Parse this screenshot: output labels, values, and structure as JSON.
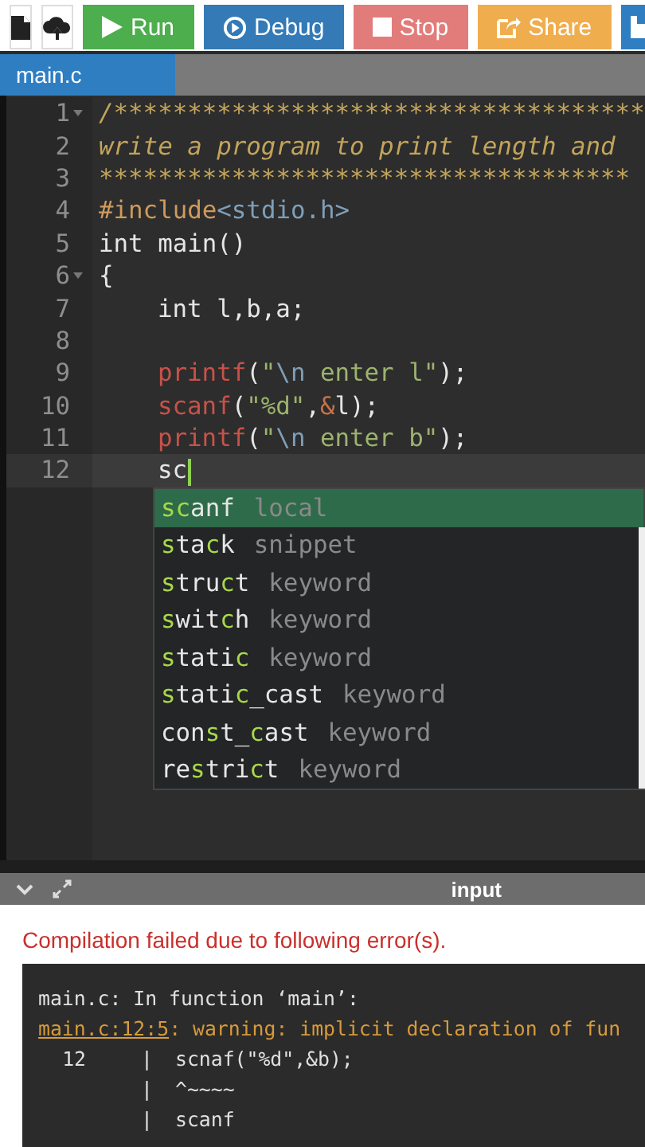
{
  "toolbar": {
    "buttons": [
      {
        "label": "Run",
        "color": "#4cae4c"
      },
      {
        "label": "Debug",
        "color": "#337ab7"
      },
      {
        "label": "Stop",
        "color": "#e27c7a"
      },
      {
        "label": "Share",
        "color": "#f0ad4e"
      }
    ]
  },
  "tabs": [
    {
      "label": "main.c",
      "selected": true
    }
  ],
  "editor": {
    "lines": [
      {
        "number": "1",
        "fold": true,
        "active": false,
        "tokens": [
          {
            "kind": "comment",
            "text": "/************************************"
          }
        ]
      },
      {
        "number": "2",
        "fold": false,
        "active": false,
        "tokens": [
          {
            "kind": "comment",
            "text": "write a program to print length and"
          }
        ]
      },
      {
        "number": "3",
        "fold": false,
        "active": false,
        "tokens": [
          {
            "kind": "comment",
            "text": "************************************"
          }
        ]
      },
      {
        "number": "4",
        "fold": false,
        "active": false,
        "tokens": [
          {
            "kind": "preproc",
            "text": "#include"
          },
          {
            "kind": "header",
            "text": "<stdio.h>"
          }
        ]
      },
      {
        "number": "5",
        "fold": false,
        "active": false,
        "tokens": [
          {
            "kind": "plain",
            "text": "int main()"
          }
        ]
      },
      {
        "number": "6",
        "fold": true,
        "active": false,
        "tokens": [
          {
            "kind": "plain",
            "text": "{"
          }
        ],
        "children": [
          {
            "number": "7",
            "fold": false,
            "active": false,
            "tokens": [
              {
                "kind": "plain",
                "text": "int l,b,a;"
              }
            ]
          },
          {
            "number": "8",
            "fold": false,
            "active": false
          },
          {
            "number": "9",
            "fold": false,
            "active": false,
            "tokens": [
              {
                "kind": "func",
                "text": "printf"
              },
              {
                "kind": "plain",
                "text": "("
              },
              {
                "kind": "string",
                "text": "\""
              },
              {
                "kind": "escape",
                "text": "\\n"
              },
              {
                "kind": "string",
                "text": " enter l\""
              },
              {
                "kind": "plain",
                "text": ");"
              }
            ]
          },
          {
            "number": "10",
            "fold": false,
            "active": false,
            "tokens": [
              {
                "kind": "func",
                "text": "scanf"
              },
              {
                "kind": "plain",
                "text": "("
              },
              {
                "kind": "string",
                "text": "\"%d\""
              },
              {
                "kind": "plain",
                "text": ","
              },
              {
                "kind": "op",
                "text": "&"
              },
              {
                "kind": "plain",
                "text": "l);"
              }
            ]
          },
          {
            "number": "11",
            "fold": false,
            "active": false,
            "tokens": [
              {
                "kind": "func",
                "text": "printf"
              },
              {
                "kind": "plain",
                "text": "("
              },
              {
                "kind": "string",
                "text": "\""
              },
              {
                "kind": "escape",
                "text": "\\n"
              },
              {
                "kind": "string",
                "text": " enter b\""
              },
              {
                "kind": "plain",
                "text": ");"
              }
            ]
          },
          {
            "number": "12",
            "fold": false,
            "active": true,
            "tokens": [
              {
                "kind": "plain",
                "text": "sc"
              }
            ]
          }
        ]
      }
    ],
    "autocomplete": [
      {
        "label": "**sc**anf",
        "meta": "local",
        "selected": true
      },
      {
        "label": "**s**ta**c**k",
        "meta": "snippet",
        "selected": false
      },
      {
        "label": "**s**tru**c**t",
        "meta": "keyword",
        "selected": false
      },
      {
        "label": "**s**wit**c**h",
        "meta": "keyword",
        "selected": false
      },
      {
        "label": "**s**tati**c**",
        "meta": "keyword",
        "selected": false
      },
      {
        "label": "**s**tati**c**_cast",
        "meta": "keyword",
        "selected": false
      },
      {
        "label": "con**s**t_**c**ast",
        "meta": "keyword",
        "selected": false
      },
      {
        "label": "re**s**tri**c**t",
        "meta": "keyword",
        "selected": false
      }
    ]
  },
  "output_bar": {
    "title": "input"
  },
  "output": {
    "status": "Compilation failed due to following error(s).",
    "console": [
      {
        "kind": "plain",
        "text": "main.c: In function ‘main’:"
      },
      {
        "kind": "warning",
        "link": "main.c:12:5",
        "text": ": warning: implicit declaration of fun"
      },
      {
        "kind": "gutter",
        "number": "12",
        "bar": "|",
        "text": "scnaf(\"%d\",&b);"
      },
      {
        "kind": "gutter",
        "bar": "|",
        "text": "^~~~~"
      },
      {
        "kind": "gutter",
        "bar": "|",
        "text": "scanf"
      }
    ]
  }
}
